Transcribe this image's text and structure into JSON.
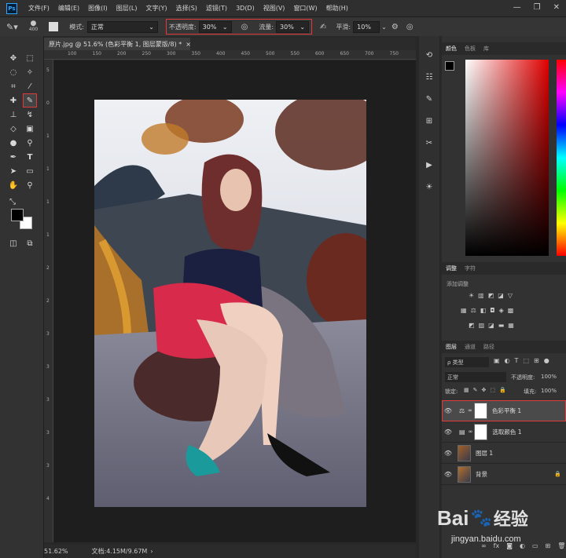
{
  "app": {
    "logo": "Ps"
  },
  "menu": [
    "文件(F)",
    "编辑(E)",
    "图像(I)",
    "图层(L)",
    "文字(Y)",
    "选择(S)",
    "滤镜(T)",
    "3D(D)",
    "视图(V)",
    "窗口(W)",
    "帮助(H)"
  ],
  "window_controls": {
    "minimize": "—",
    "restore": "❐",
    "close": "✕"
  },
  "options": {
    "brush_size": "400",
    "mode_label": "模式:",
    "mode_value": "正常",
    "opacity_label": "不透明度:",
    "opacity_value": "30%",
    "flow_label": "流量:",
    "flow_value": "30%",
    "smooth_label": "平滑:",
    "smooth_value": "10%"
  },
  "document": {
    "tab_title": "原片.jpg @ 51.6% (色彩平衡 1, 图层蒙版/8) *",
    "tab_close": "×"
  },
  "ruler_h": [
    "100",
    "150",
    "200",
    "250",
    "300",
    "350",
    "400",
    "450",
    "500",
    "550",
    "600",
    "650",
    "700",
    "750"
  ],
  "ruler_v": [
    "5",
    "0",
    "1",
    "1",
    "1",
    "1",
    "2",
    "2",
    "3",
    "3",
    "3",
    "3",
    "3",
    "4"
  ],
  "status": {
    "zoom": "51.62%",
    "doc": "文档:4.15M/9.67M"
  },
  "panels": {
    "color_tabs": [
      "颜色",
      "色板",
      "库"
    ],
    "adjust_tabs": [
      "调整",
      "字符"
    ],
    "adjust_title": "添加调整",
    "layer_tabs": [
      "图层",
      "通道",
      "路径"
    ],
    "filter_label": "ρ 类型",
    "blend_mode": "正常",
    "opacity_label": "不透明度:",
    "opacity_value": "100%",
    "lock_label": "锁定:",
    "fill_label": "填充:",
    "fill_value": "100%"
  },
  "layers": [
    {
      "name": "色彩平衡 1",
      "selected": true
    },
    {
      "name": "选取颜色 1",
      "selected": false
    },
    {
      "name": "图层 1",
      "selected": false
    },
    {
      "name": "背景",
      "selected": false
    }
  ],
  "watermark": {
    "brand": "Bai",
    "brand2": "经验",
    "url": "jingyan.baidu.com"
  },
  "colors": {
    "accent_red": "#e03a3a",
    "ps_blue": "#31a8ff"
  }
}
